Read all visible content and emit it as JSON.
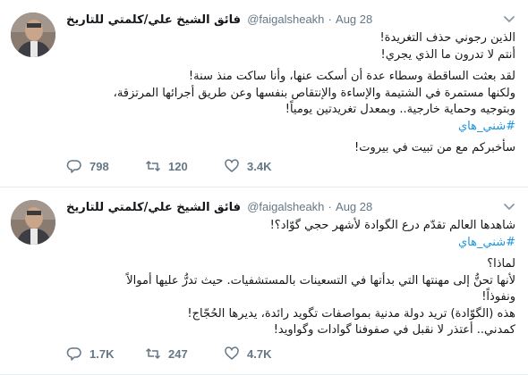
{
  "tweets": [
    {
      "author_name": "فائق الشيخ علي/كلمتي للتاريخ",
      "handle": "@faigalsheakh",
      "dot": "·",
      "time": "Aug 28",
      "lines": [
        "الذين رجوني حذف التغريدة!",
        "أنتم لا تدرون ما الذي يجري!",
        "لقد بعثت الساقطة وسطاء عدة أن أسكت عنها، وأنا ساكت منذ سنة!",
        "ولكنها مستمرة في الشتيمة والإساءة والإنتقاص بنفسها وعن طريق أجرائها المرتزقة،",
        "وبتوجيه وحماية خارجية.. وبمعدل تغريدتين يومياً!"
      ],
      "hashtag": "#شني_هاي",
      "closing": "سأخبركم مع من تبيت في بيروت!",
      "replies": "798",
      "retweets": "120",
      "likes": "3.4K"
    },
    {
      "author_name": "فائق الشيخ علي/كلمتي للتاريخ",
      "handle": "@faigalsheakh",
      "dot": "·",
      "time": "Aug 28",
      "lines_before": [
        "شاهدها العالم تقدّم درع الگوادة لأشهر حجي گوّاد؟!"
      ],
      "hashtag": "#شني_هاي",
      "lines_after": [
        "لماذا؟",
        "لأنها تحنُّ إلى مهنتها التي بدأتها في التسعينات بالمستشفيات. حيث تدرُّ عليها أموالاً",
        "ونفوذاً!",
        "هذه (الگوّادة) تريد دولة مدنية بمواصفات تگويد رائدة، يديرها الحُجّاج!",
        "كمدني.. أعتذر لا نقبل في صفوفنا گوادات وگواويد!"
      ],
      "replies": "1.7K",
      "retweets": "247",
      "likes": "4.7K"
    }
  ],
  "icons": {
    "avatar": "avatar-photo",
    "caret": "chevron-down-icon",
    "reply": "reply-icon",
    "retweet": "retweet-icon",
    "like": "heart-icon"
  },
  "colors": {
    "link": "#1b95e0",
    "muted": "#657786",
    "text": "#14171a",
    "divider": "#e6ecf0"
  }
}
